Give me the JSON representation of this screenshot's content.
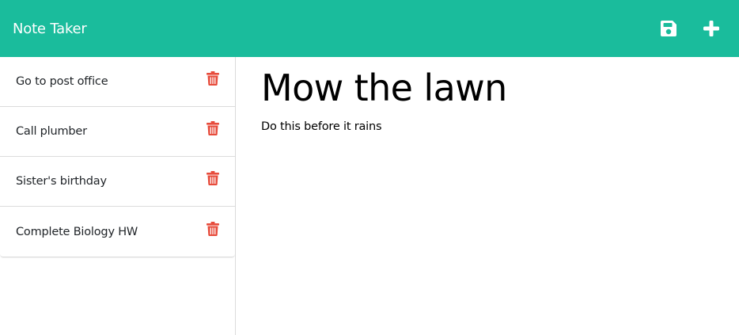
{
  "app": {
    "title": "Note Taker",
    "accent_color": "#1abc9c",
    "danger_color": "#e74c3c"
  },
  "toolbar": {
    "save_icon": "save-icon",
    "add_icon": "plus-icon"
  },
  "sidebar": {
    "items": [
      {
        "label": "Go to post office",
        "icon": "trash-icon"
      },
      {
        "label": "Call plumber",
        "icon": "trash-icon"
      },
      {
        "label": "Sister's birthday",
        "icon": "trash-icon"
      },
      {
        "label": "Complete Biology HW",
        "icon": "trash-icon"
      }
    ]
  },
  "main": {
    "title": "Mow the lawn",
    "body": "Do this before it rains"
  }
}
